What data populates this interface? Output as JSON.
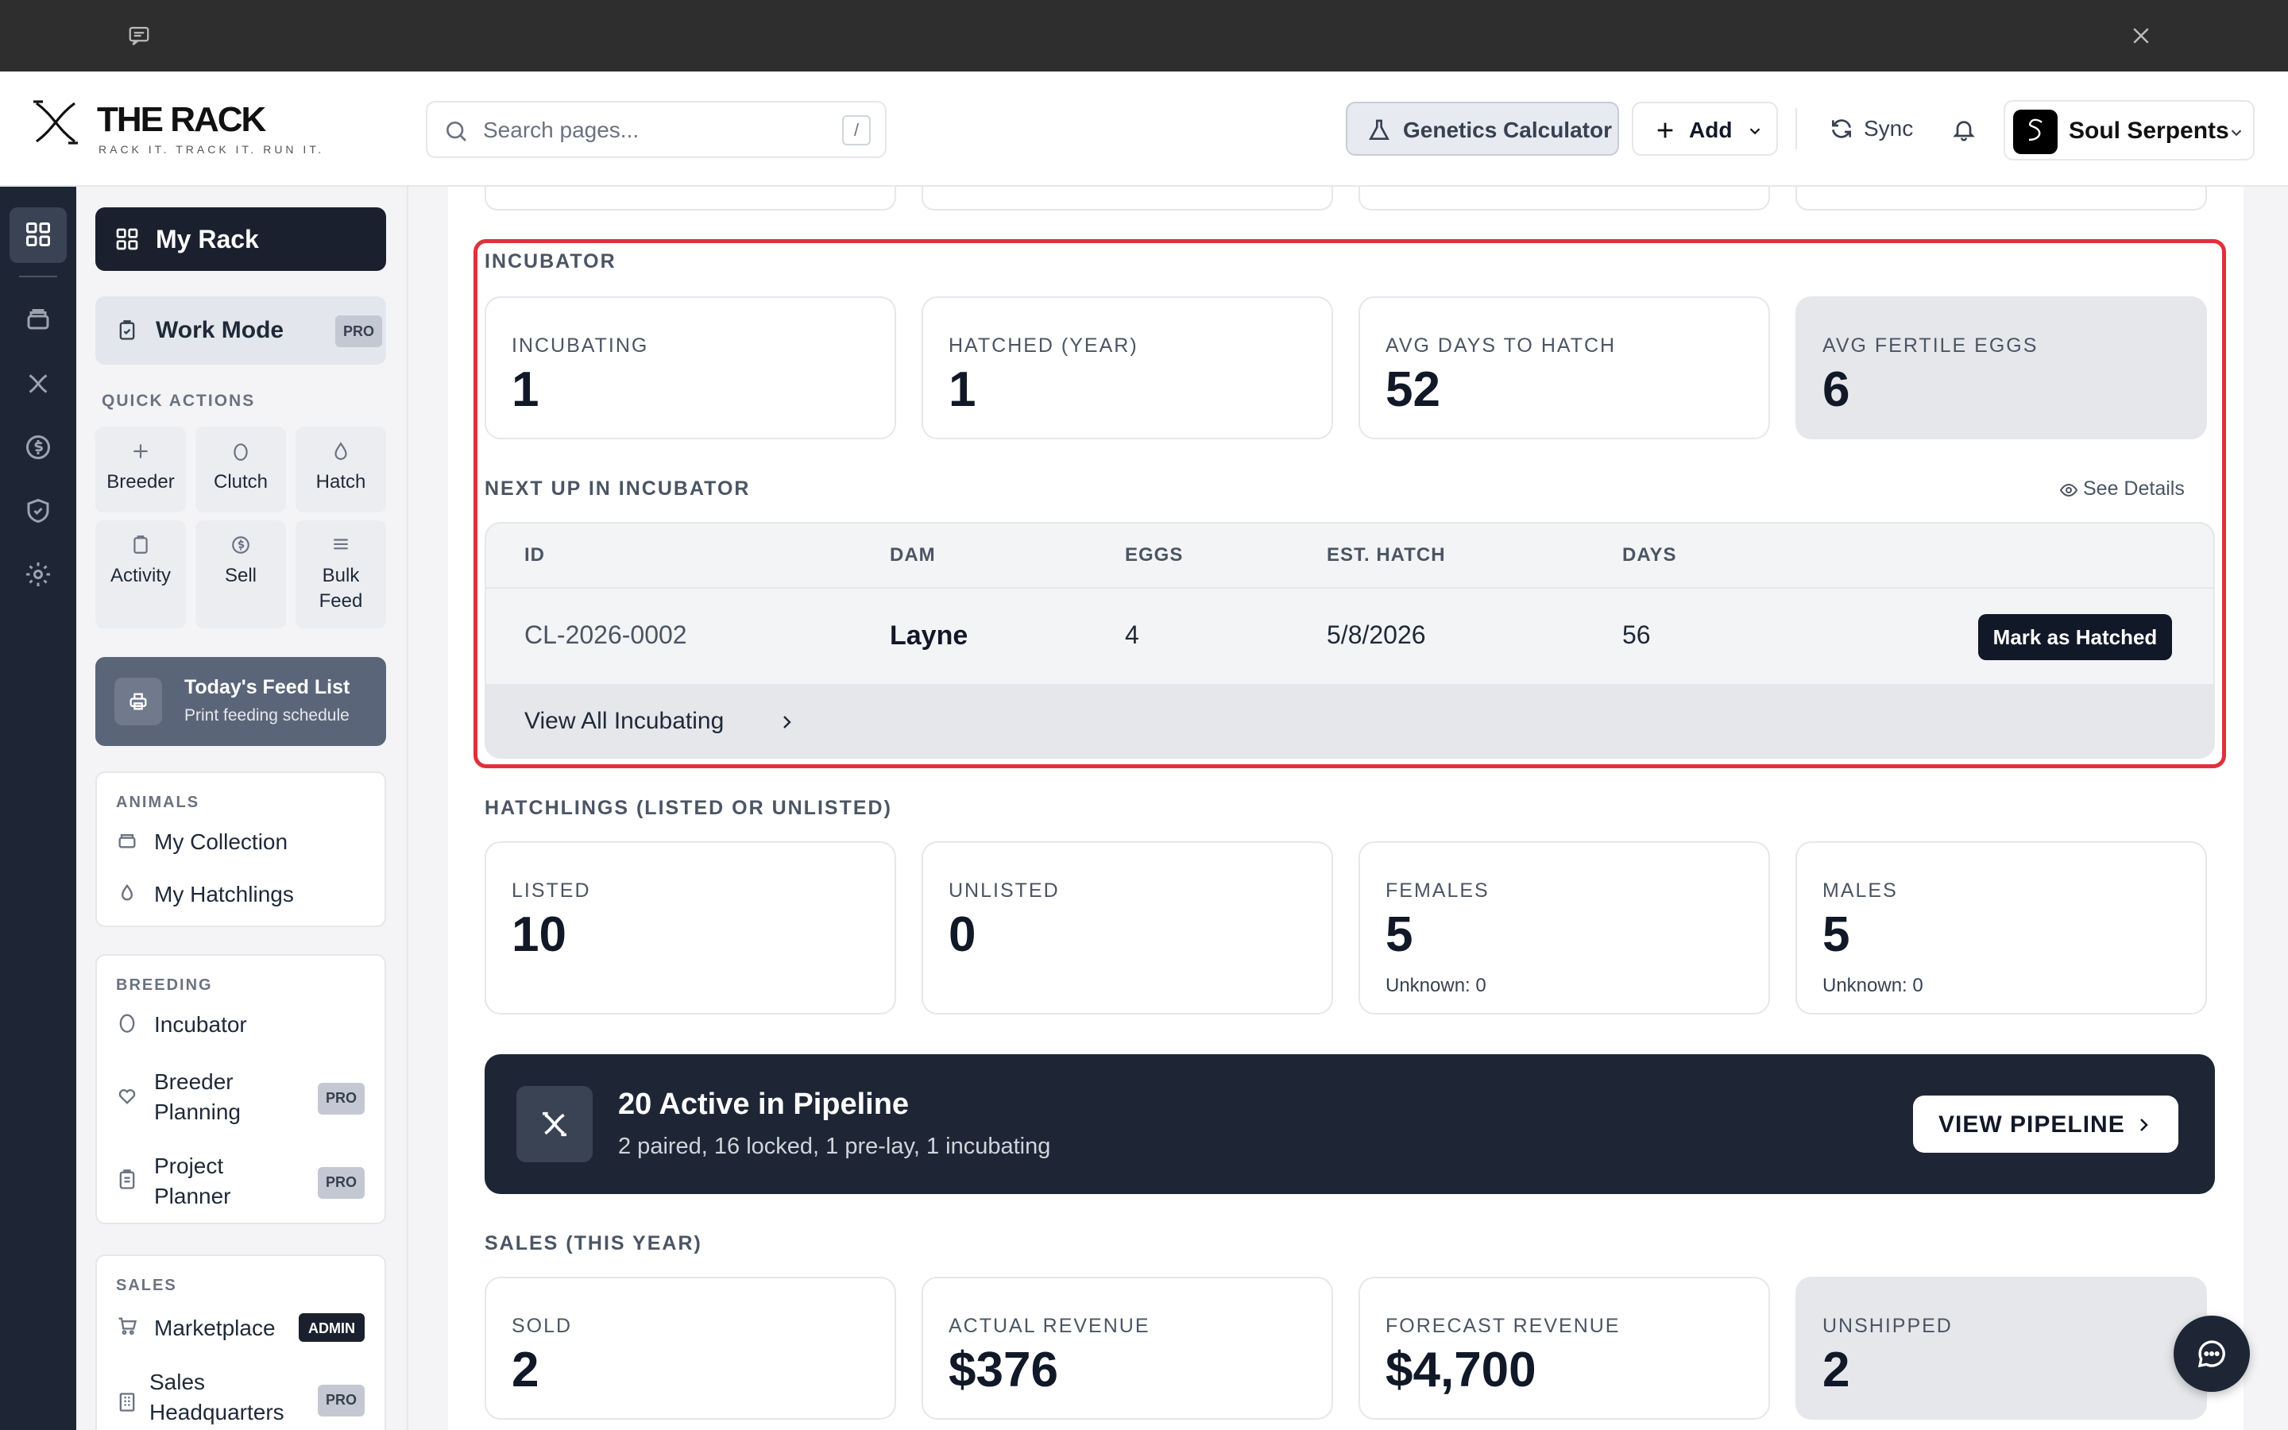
{
  "header": {
    "brand": "THE RACK",
    "tagline": "RACK IT. TRACK IT. RUN IT.",
    "search_placeholder": "Search pages...",
    "search_shortcut": "/",
    "genetics_label": "Genetics Calculator",
    "add_label": "Add",
    "sync_label": "Sync",
    "account_name": "Soul Serpents"
  },
  "sidebar": {
    "my_rack": "My Rack",
    "work_mode": "Work Mode",
    "pro_badge": "PRO",
    "admin_badge": "ADMIN",
    "quick_actions_title": "QUICK ACTIONS",
    "quick_actions": [
      {
        "label": "Breeder",
        "icon": "plus-icon"
      },
      {
        "label": "Clutch",
        "icon": "egg-icon"
      },
      {
        "label": "Hatch",
        "icon": "drop-icon"
      },
      {
        "label": "Activity",
        "icon": "clipboard-icon"
      },
      {
        "label": "Sell",
        "icon": "dollar-icon"
      },
      {
        "label": "Bulk\nFeed",
        "icon": "list-icon"
      }
    ],
    "feed_list": {
      "title": "Today's Feed List",
      "subtitle": "Print feeding schedule"
    },
    "animals": {
      "title": "ANIMALS",
      "items": [
        "My Collection",
        "My Hatchlings"
      ]
    },
    "breeding": {
      "title": "BREEDING",
      "items": [
        "Incubator",
        "Breeder\nPlanning",
        "Project\nPlanner"
      ]
    },
    "sales": {
      "title": "SALES",
      "items": [
        "Marketplace",
        "Sales\nHeadquarters"
      ]
    }
  },
  "incubator": {
    "title": "INCUBATOR",
    "stats": [
      {
        "label": "INCUBATING",
        "value": "1"
      },
      {
        "label": "HATCHED (YEAR)",
        "value": "1"
      },
      {
        "label": "AVG DAYS TO HATCH",
        "value": "52"
      },
      {
        "label": "AVG FERTILE EGGS",
        "value": "6"
      }
    ],
    "next_up_title": "NEXT UP IN INCUBATOR",
    "see_details": "See Details",
    "columns": [
      "ID",
      "DAM",
      "EGGS",
      "EST. HATCH",
      "DAYS"
    ],
    "rows": [
      {
        "id": "CL-2026-0002",
        "dam": "Layne",
        "eggs": "4",
        "est_hatch": "5/8/2026",
        "days": "56",
        "action": "Mark as Hatched"
      }
    ],
    "view_all": "View All Incubating"
  },
  "hatchlings": {
    "title": "HATCHLINGS (LISTED OR UNLISTED)",
    "stats": [
      {
        "label": "LISTED",
        "value": "10",
        "sub": ""
      },
      {
        "label": "UNLISTED",
        "value": "0",
        "sub": ""
      },
      {
        "label": "FEMALES",
        "value": "5",
        "sub": "Unknown: 0"
      },
      {
        "label": "MALES",
        "value": "5",
        "sub": "Unknown: 0"
      }
    ]
  },
  "pipeline": {
    "title": "20 Active in Pipeline",
    "subtitle": "2 paired, 16 locked, 1 pre-lay, 1 incubating",
    "button": "VIEW PIPELINE"
  },
  "sales": {
    "title": "SALES (THIS YEAR)",
    "stats": [
      {
        "label": "SOLD",
        "value": "2"
      },
      {
        "label": "ACTUAL REVENUE",
        "value": "$376"
      },
      {
        "label": "FORECAST REVENUE",
        "value": "$4,700"
      },
      {
        "label": "UNSHIPPED",
        "value": "2"
      }
    ]
  },
  "colors": {
    "dark": "#1e2636",
    "highlight": "#e0303a",
    "accent_grey": "#e5e7eb"
  }
}
